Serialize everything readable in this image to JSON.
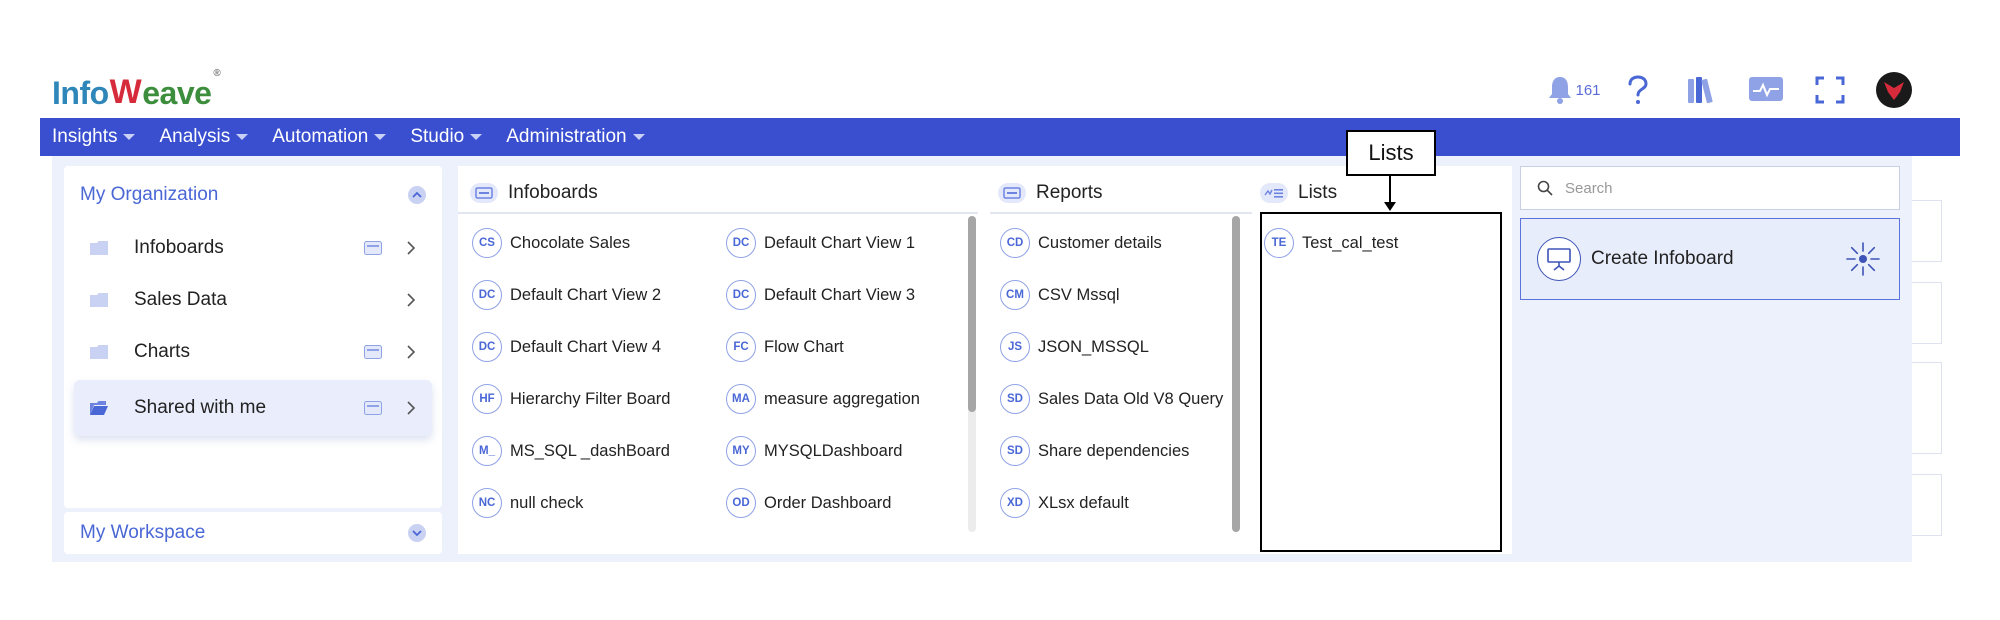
{
  "logo": {
    "part1": "Info",
    "mark": "W",
    "part2": "eave",
    "reg": "®"
  },
  "header": {
    "notification_count": "161"
  },
  "nav": [
    {
      "label": "Insights"
    },
    {
      "label": "Analysis"
    },
    {
      "label": "Automation"
    },
    {
      "label": "Studio"
    },
    {
      "label": "Administration"
    }
  ],
  "sidebar": {
    "section_title": "My Organization",
    "items": [
      {
        "label": "Infoboards"
      },
      {
        "label": "Sales Data"
      },
      {
        "label": "Charts"
      },
      {
        "label": "Shared with me"
      }
    ],
    "workspace_title": "My Workspace"
  },
  "columns": {
    "infoboards": {
      "title": "Infoboards",
      "items": [
        {
          "badge": "CS",
          "label": "Chocolate Sales"
        },
        {
          "badge": "DC",
          "label": "Default Chart View 1"
        },
        {
          "badge": "DC",
          "label": "Default Chart View 2"
        },
        {
          "badge": "DC",
          "label": "Default Chart View 3"
        },
        {
          "badge": "DC",
          "label": "Default Chart View 4"
        },
        {
          "badge": "FC",
          "label": "Flow Chart"
        },
        {
          "badge": "HF",
          "label": "Hierarchy Filter Board"
        },
        {
          "badge": "MA",
          "label": "measure aggregation"
        },
        {
          "badge": "M_",
          "label": "MS_SQL _dashBoard"
        },
        {
          "badge": "MY",
          "label": "MYSQLDashboard"
        },
        {
          "badge": "NC",
          "label": "null check"
        },
        {
          "badge": "OD",
          "label": "Order Dashboard"
        }
      ]
    },
    "reports": {
      "title": "Reports",
      "items": [
        {
          "badge": "CD",
          "label": "Customer details"
        },
        {
          "badge": "CM",
          "label": "CSV Mssql"
        },
        {
          "badge": "JS",
          "label": "JSON_MSSQL"
        },
        {
          "badge": "SD",
          "label": "Sales Data Old V8 Query"
        },
        {
          "badge": "SD",
          "label": "Share dependencies"
        },
        {
          "badge": "XD",
          "label": "XLsx default"
        }
      ]
    },
    "lists": {
      "title": "Lists",
      "items": [
        {
          "badge": "TE",
          "label": "Test_cal_test"
        }
      ]
    }
  },
  "annotation": {
    "label": "Lists"
  },
  "search": {
    "placeholder": "Search"
  },
  "create": {
    "label": "Create Infoboard"
  },
  "colors": {
    "accent": "#3a4fcf",
    "link": "#4a67d6",
    "panel": "#edf1fb"
  }
}
